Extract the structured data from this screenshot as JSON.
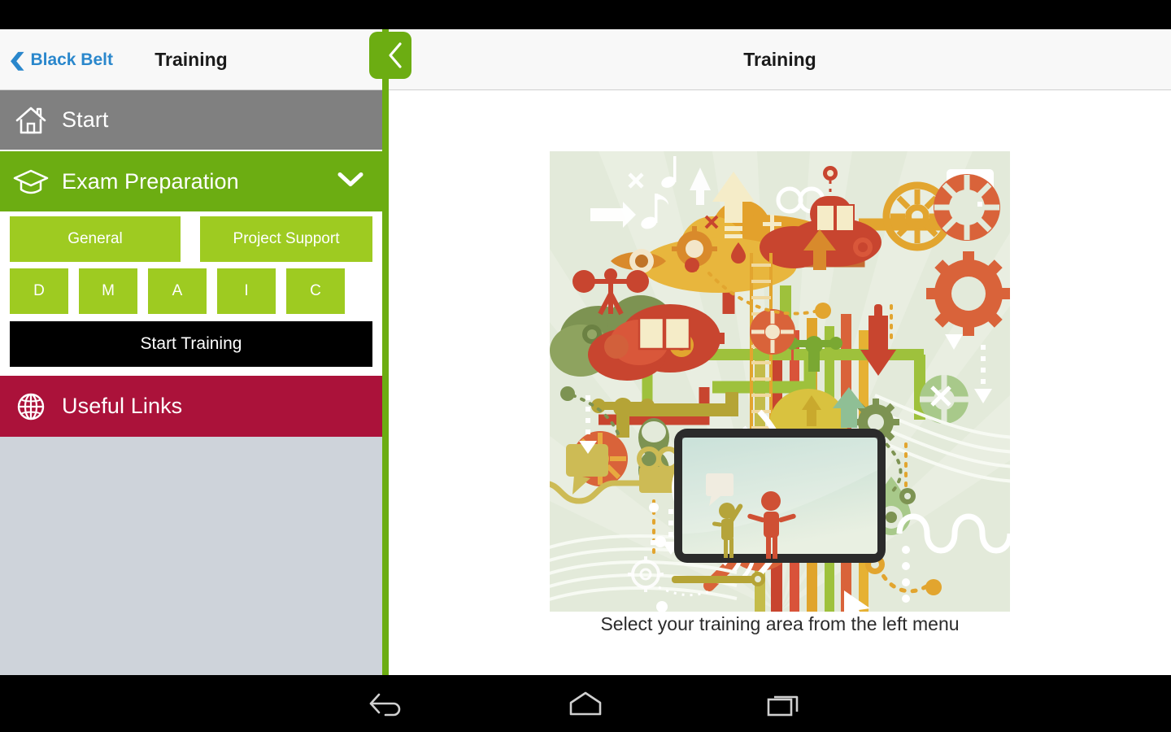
{
  "app": {
    "status_bar_color": "#000000",
    "accent_green": "#6cad12",
    "light_green": "#9ecb21",
    "crimson": "#ab123a",
    "grey": "#808080",
    "link_blue": "#2a87cc"
  },
  "left_panel": {
    "back_label": "Black Belt",
    "back_chevron": "chevron-left-icon",
    "title": "Training",
    "menu": [
      {
        "label": "Start",
        "icon": "home-icon",
        "state": "inactive"
      },
      {
        "label": "Exam Preparation",
        "icon": "graduation-cap-icon",
        "state": "expanded",
        "chevron": "chevron-down-icon"
      },
      {
        "label": "Useful Links",
        "icon": "globe-icon",
        "state": "inactive"
      }
    ],
    "exam_submenu": {
      "categories": [
        "General",
        "Project Support"
      ],
      "phases": [
        "D",
        "M",
        "A",
        "I",
        "C"
      ],
      "start_button": "Start Training"
    }
  },
  "right_panel": {
    "back_button_icon": "chevron-left-icon",
    "title": "Training",
    "caption": "Select your training area from the left menu",
    "illustration": "training-infographic-illustration"
  },
  "nav_bar": {
    "buttons": [
      {
        "name": "back",
        "icon": "android-back-icon"
      },
      {
        "name": "home",
        "icon": "android-home-icon"
      },
      {
        "name": "recents",
        "icon": "android-recents-icon"
      }
    ]
  }
}
